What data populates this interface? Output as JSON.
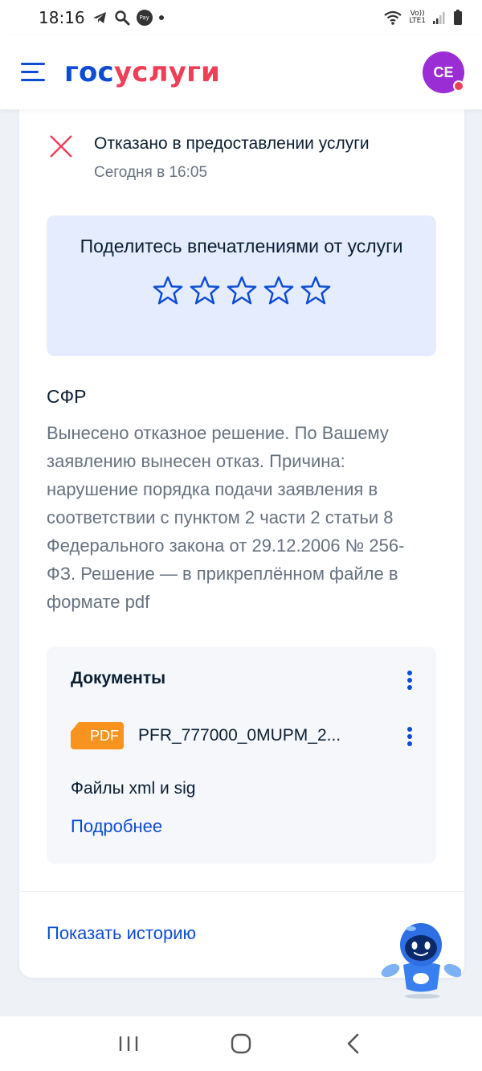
{
  "status_bar": {
    "time": "18:16",
    "pay_label": "Pay",
    "volte_line1": "Vo))",
    "volte_line2": "LTE1"
  },
  "header": {
    "logo_part1": "гос",
    "logo_part2": "услуги",
    "avatar_initials": "CE",
    "brand_color": "#0d4cd3",
    "accent_color": "#ee3f58"
  },
  "status": {
    "title": "Отказано в предоставлении услуги",
    "time": "Сегодня в 16:05",
    "icon": "close-icon"
  },
  "feedback": {
    "text": "Поделитесь впечатлениями от услуги",
    "rating": 0,
    "max_rating": 5
  },
  "org": "СФР",
  "description": "Вынесено отказное решение. По Вашему заявлению вынесен отказ. Причина: нарушение порядка подачи заявления в соответствии с пунктом 2 части 2 статьи 8 Федерального закона от 29.12.2006 № 256-ФЗ. Решение — в прикреплённом файле в формате pdf",
  "documents": {
    "title": "Документы",
    "file_type": "PDF",
    "file_name": "PFR_777000_0MUPM_2...",
    "files_note": "Файлы xml и sig",
    "more_link": "Подробнее"
  },
  "history_link": "Показать историю"
}
